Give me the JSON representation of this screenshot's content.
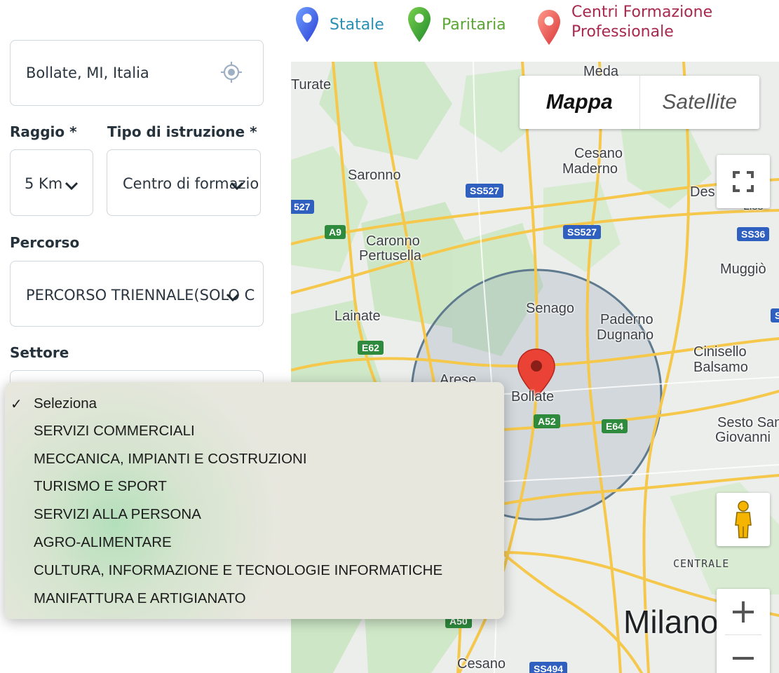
{
  "legend": {
    "statale": {
      "label": "Statale",
      "color": "#2a8fb5",
      "pin_color": "#4a6cf0"
    },
    "paritaria": {
      "label": "Paritaria",
      "color": "#5aa632",
      "pin_color": "#3aa63a"
    },
    "cfp": {
      "label_line1": "Centri Formazione",
      "label_line2": "Professionale",
      "color": "#a8284e",
      "pin_color": "#ee5e5e"
    }
  },
  "form": {
    "location_value": "Bollate, MI, Italia",
    "raggio_label": "Raggio *",
    "raggio_value": "5 Km",
    "tipo_label": "Tipo di istruzione *",
    "tipo_value": "Centro di formazione",
    "percorso_label": "Percorso",
    "percorso_value": "PERCORSO TRIENNALE(SOLO C",
    "settore_label": "Settore"
  },
  "dropdown": {
    "options": [
      {
        "label": "Seleziona",
        "selected": true
      },
      {
        "label": "SERVIZI COMMERCIALI",
        "selected": false
      },
      {
        "label": "MECCANICA, IMPIANTI E COSTRUZIONI",
        "selected": false
      },
      {
        "label": "TURISMO E SPORT",
        "selected": false
      },
      {
        "label": "SERVIZI ALLA PERSONA",
        "selected": false
      },
      {
        "label": "AGRO-ALIMENTARE",
        "selected": false
      },
      {
        "label": "CULTURA, INFORMAZIONE E TECNOLOGIE INFORMATICHE",
        "selected": false
      },
      {
        "label": "MANIFATTURA E ARTIGIANATO",
        "selected": false
      }
    ],
    "check_glyph": "✓"
  },
  "map": {
    "type_buttons": {
      "map": "Mappa",
      "satellite": "Satellite"
    },
    "places": {
      "turate": "Turate",
      "meda": "Meda",
      "cesano_maderno_1": "Cesano",
      "cesano_maderno_2": "Maderno",
      "saronno": "Saronno",
      "desio": "Des",
      "lissone": "Liss",
      "caronno_1": "Caronno",
      "caronno_2": "Pertusella",
      "muggio": "Muggiò",
      "senago": "Senago",
      "lainate": "Lainate",
      "paderno_1": "Paderno",
      "paderno_2": "Dugnano",
      "cinisello_1": "Cinisello",
      "cinisello_2": "Balsamo",
      "arese": "Arese",
      "bollate": "Bollate",
      "sesto_1": "Sesto San",
      "sesto_2": "Giovanni",
      "centrale": "CENTRALE",
      "milano": "Milano",
      "cesano_boscone": "Cesano"
    },
    "shields": {
      "ss527_a": "SS527",
      "s527_left": "527",
      "a9": "A9",
      "ss527_b": "SS527",
      "ss36": "SS36",
      "s_right": "S",
      "e62": "E62",
      "a52": "A52",
      "e64": "E64",
      "ss494": "SS494",
      "a50": "A50"
    },
    "zoom_in": "+",
    "zoom_out": "−",
    "circle_radius_km": 5
  }
}
